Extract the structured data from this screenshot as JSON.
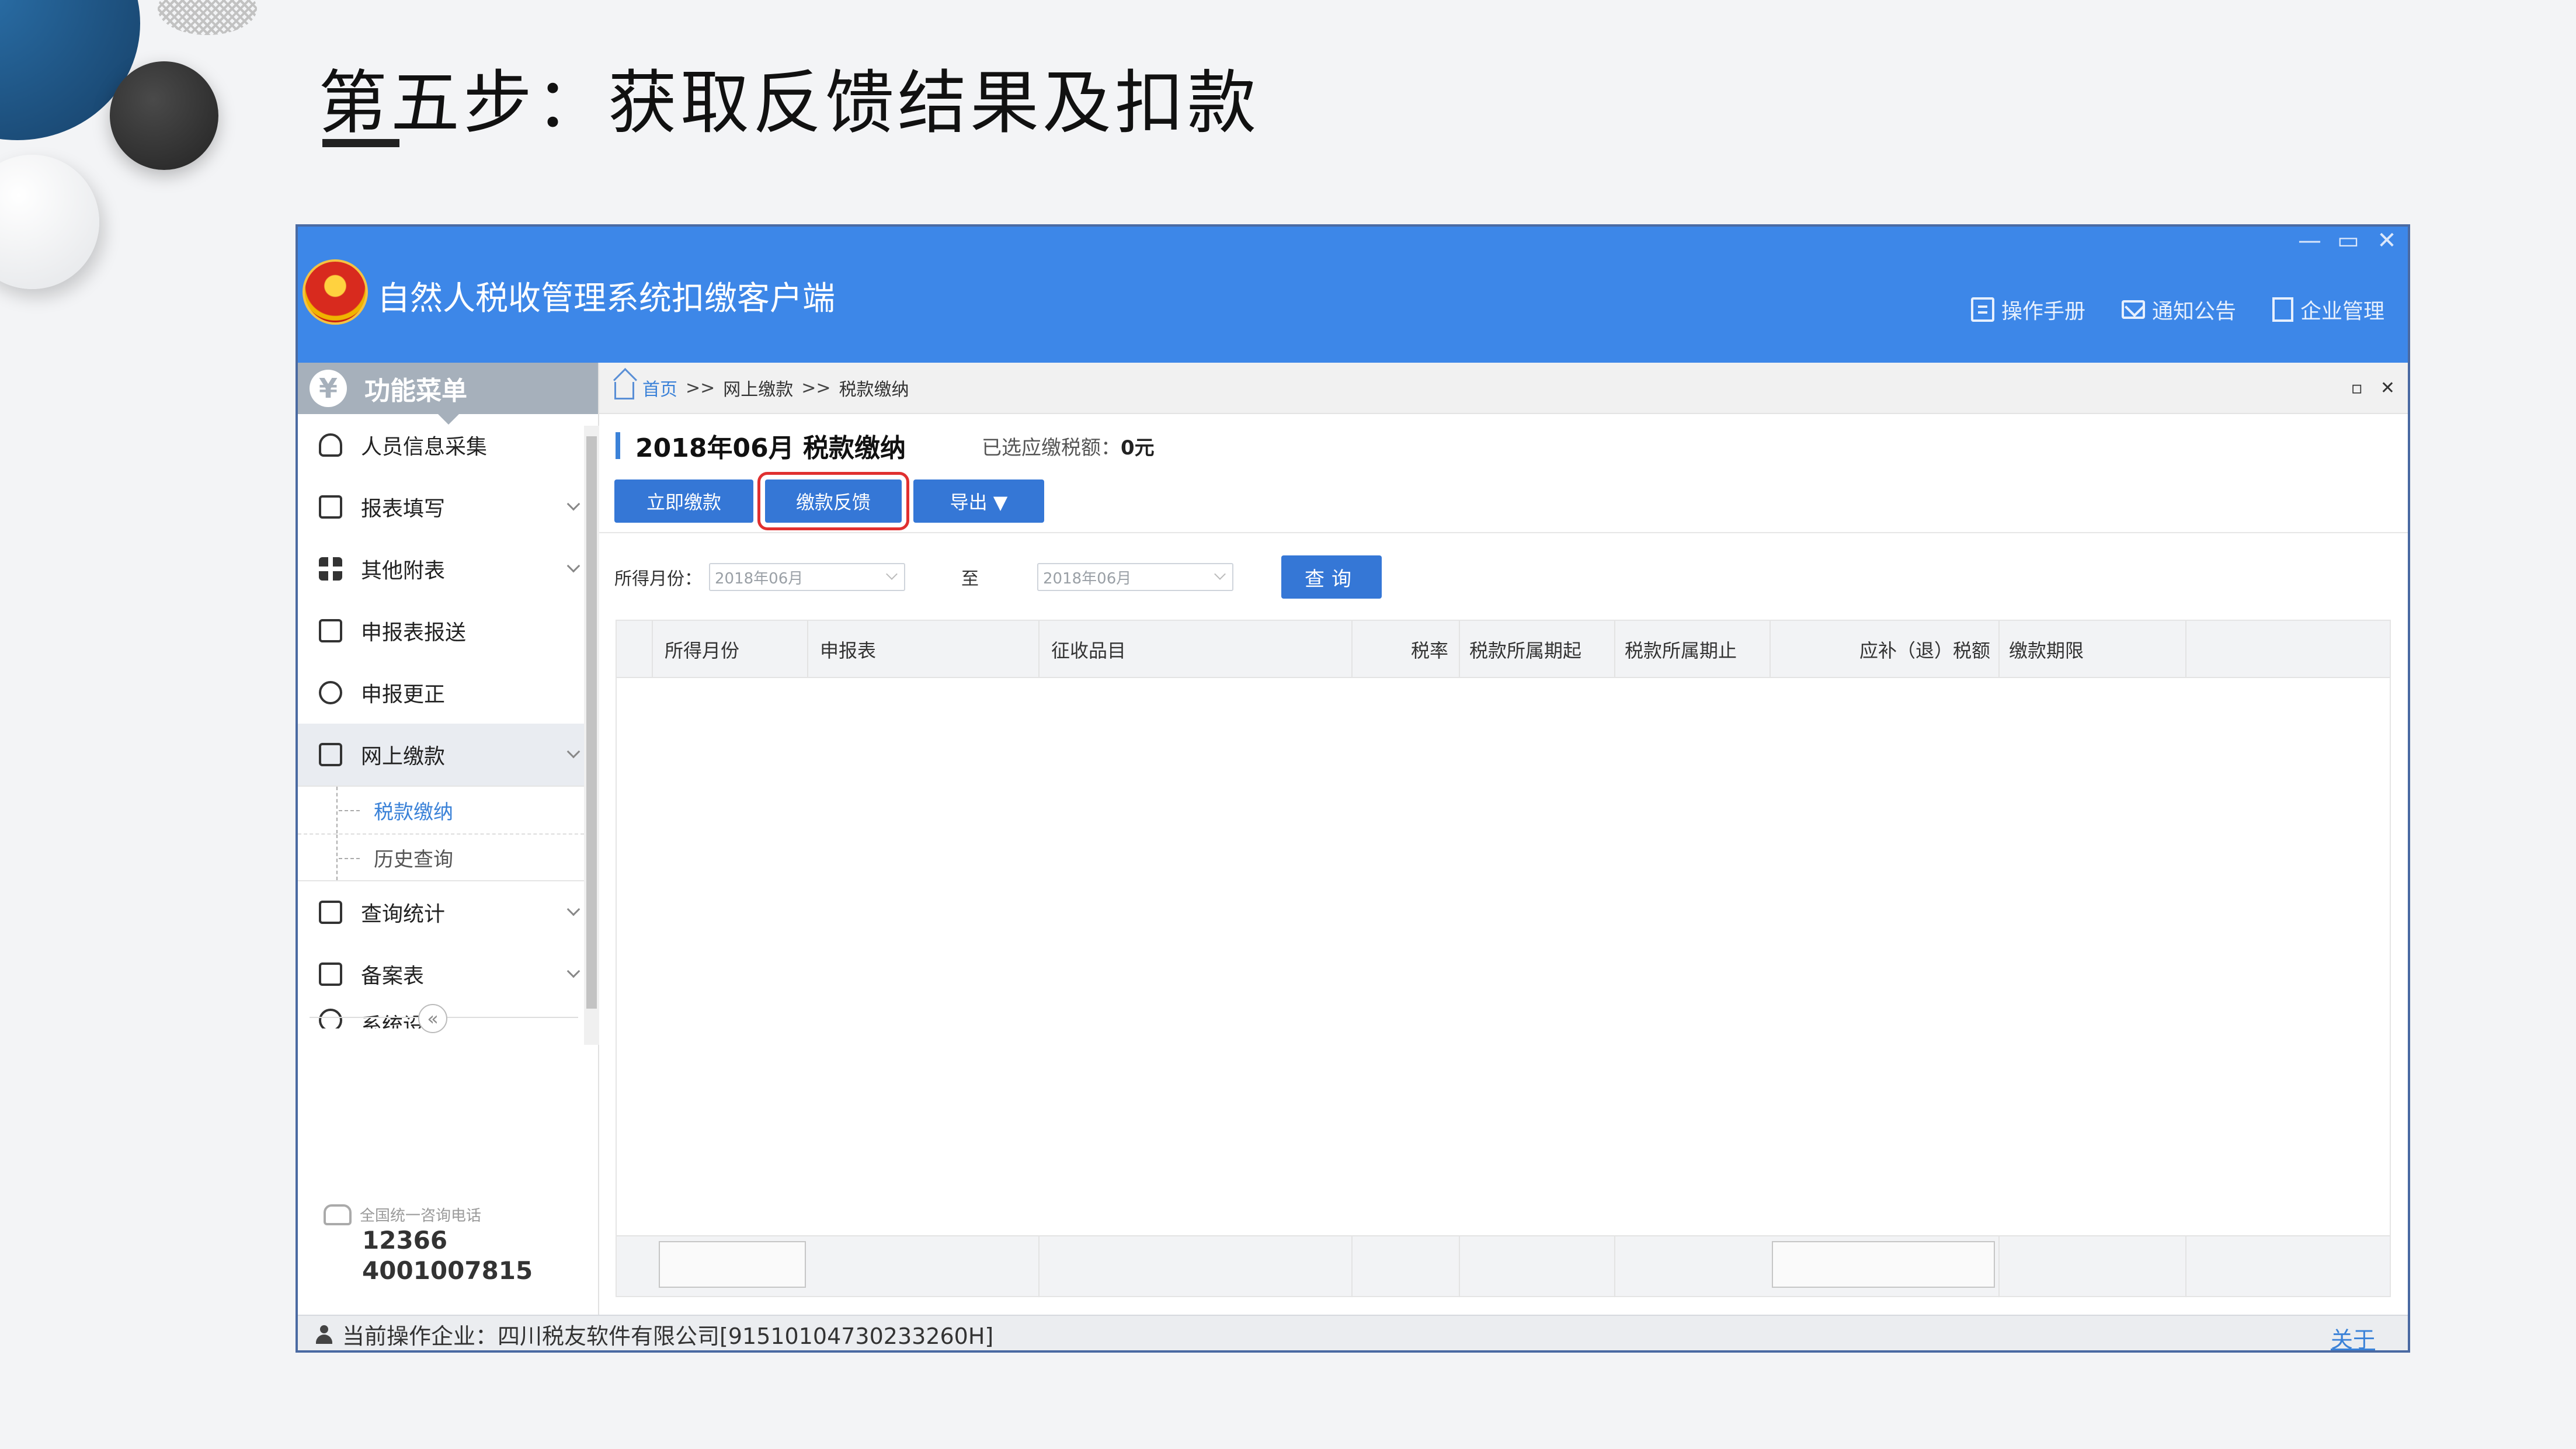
{
  "slide": {
    "title": "第五步：获取反馈结果及扣款"
  },
  "window": {
    "app_title": "自然人税收管理系统扣缴客户端",
    "controls": [
      "—",
      "▭",
      "✕"
    ],
    "header_links": [
      "操作手册",
      "通知公告",
      "企业管理"
    ]
  },
  "sidebar": {
    "header": "功能菜单",
    "items": [
      {
        "label": "人员信息采集",
        "icon": "person-icon",
        "has_arrow": false
      },
      {
        "label": "报表填写",
        "icon": "edit-icon",
        "has_arrow": true
      },
      {
        "label": "其他附表",
        "icon": "grid-icon",
        "has_arrow": true
      },
      {
        "label": "申报表报送",
        "icon": "report-send-icon",
        "has_arrow": false
      },
      {
        "label": "申报更正",
        "icon": "search-icon",
        "has_arrow": false
      },
      {
        "label": "网上缴款",
        "icon": "folder-icon",
        "has_arrow": true,
        "expanded": true
      },
      {
        "label": "查询统计",
        "icon": "stats-search-icon",
        "has_arrow": true
      },
      {
        "label": "备案表",
        "icon": "copy-icon",
        "has_arrow": true
      },
      {
        "label": "系统设置",
        "icon": "gear-icon",
        "has_arrow": false
      }
    ],
    "sub_items": [
      "税款缴纳",
      "历史查询"
    ],
    "collapse_glyph": "«",
    "hotline_label": "全国统一咨询电话",
    "hotline_numbers": [
      "12366",
      "4001007815"
    ]
  },
  "breadcrumb": {
    "home": "首页",
    "sep": ">>",
    "level1": "网上缴款",
    "level2": "税款缴纳",
    "controls": [
      "▫",
      "✕"
    ]
  },
  "page": {
    "title": "2018年06月  税款缴纳",
    "selected_label": "已选应缴税额：",
    "selected_value": "0元"
  },
  "buttons": {
    "pay_now": "立即缴款",
    "feedback": "缴款反馈",
    "export": "导出 ▼"
  },
  "filter": {
    "month_label": "所得月份：",
    "from": "2018年06月",
    "to_label": "至",
    "to": "2018年06月",
    "query": "查询"
  },
  "table": {
    "columns": [
      "所得月份",
      "申报表",
      "征收品目",
      "税率",
      "税款所属期起",
      "税款所属期止",
      "应补（退）税额",
      "缴款期限"
    ],
    "rows": []
  },
  "statusbar": {
    "label": "当前操作企业：",
    "company": "四川税友软件有限公司[91510104730233260H]",
    "about": "关于"
  }
}
